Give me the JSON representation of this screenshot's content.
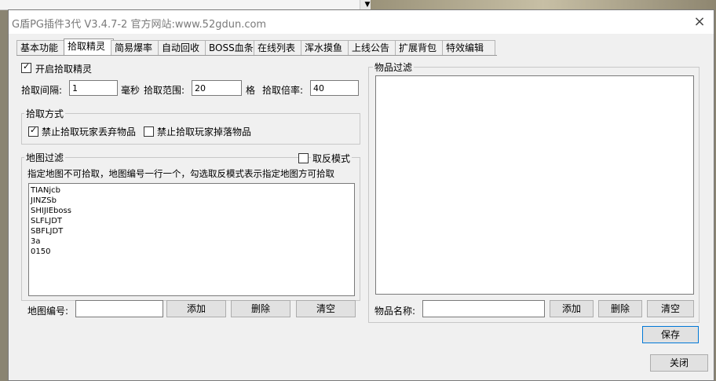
{
  "window": {
    "title": "G盾PG插件3代 V3.4.7-2  官方网站:www.52gdun.com",
    "close_glyph": "×"
  },
  "tabs": [
    "基本功能",
    "拾取精灵",
    "简易爆率",
    "自动回收",
    "BOSS血条",
    "在线列表",
    "浑水摸鱼",
    "上线公告",
    "扩展背包",
    "特效编辑"
  ],
  "active_tab": "拾取精灵",
  "pickup": {
    "enable_label": "开启拾取精灵",
    "enable_checked": true,
    "interval_label": "拾取间隔:",
    "interval_value": "1",
    "interval_unit": "毫秒",
    "range_label": "拾取范围:",
    "range_value": "20",
    "range_unit": "格",
    "rate_label": "拾取倍率:",
    "rate_value": "40"
  },
  "method": {
    "title": "拾取方式",
    "no_drop_label": "禁止拾取玩家丢弃物品",
    "no_drop_checked": true,
    "no_fall_label": "禁止拾取玩家掉落物品",
    "no_fall_checked": false
  },
  "map_filter": {
    "title": "地图过滤",
    "reverse_label": "取反模式",
    "reverse_checked": false,
    "hint": "指定地图不可拾取，地图编号一行一个，勾选取反模式表示指定地图方可拾取",
    "entries": [
      "TIANjcb",
      "JINZSb",
      "SHIJIEboss",
      "SLFLJDT",
      "SBFLJDT",
      "3a",
      "0150"
    ],
    "id_label": "地图编号:",
    "id_value": "",
    "add_label": "添加",
    "delete_label": "删除",
    "clear_label": "清空"
  },
  "item_filter": {
    "title": "物品过滤",
    "name_label": "物品名称:",
    "name_value": "",
    "add_label": "添加",
    "delete_label": "删除",
    "clear_label": "清空"
  },
  "save_label": "保存",
  "close_label": "关闭"
}
